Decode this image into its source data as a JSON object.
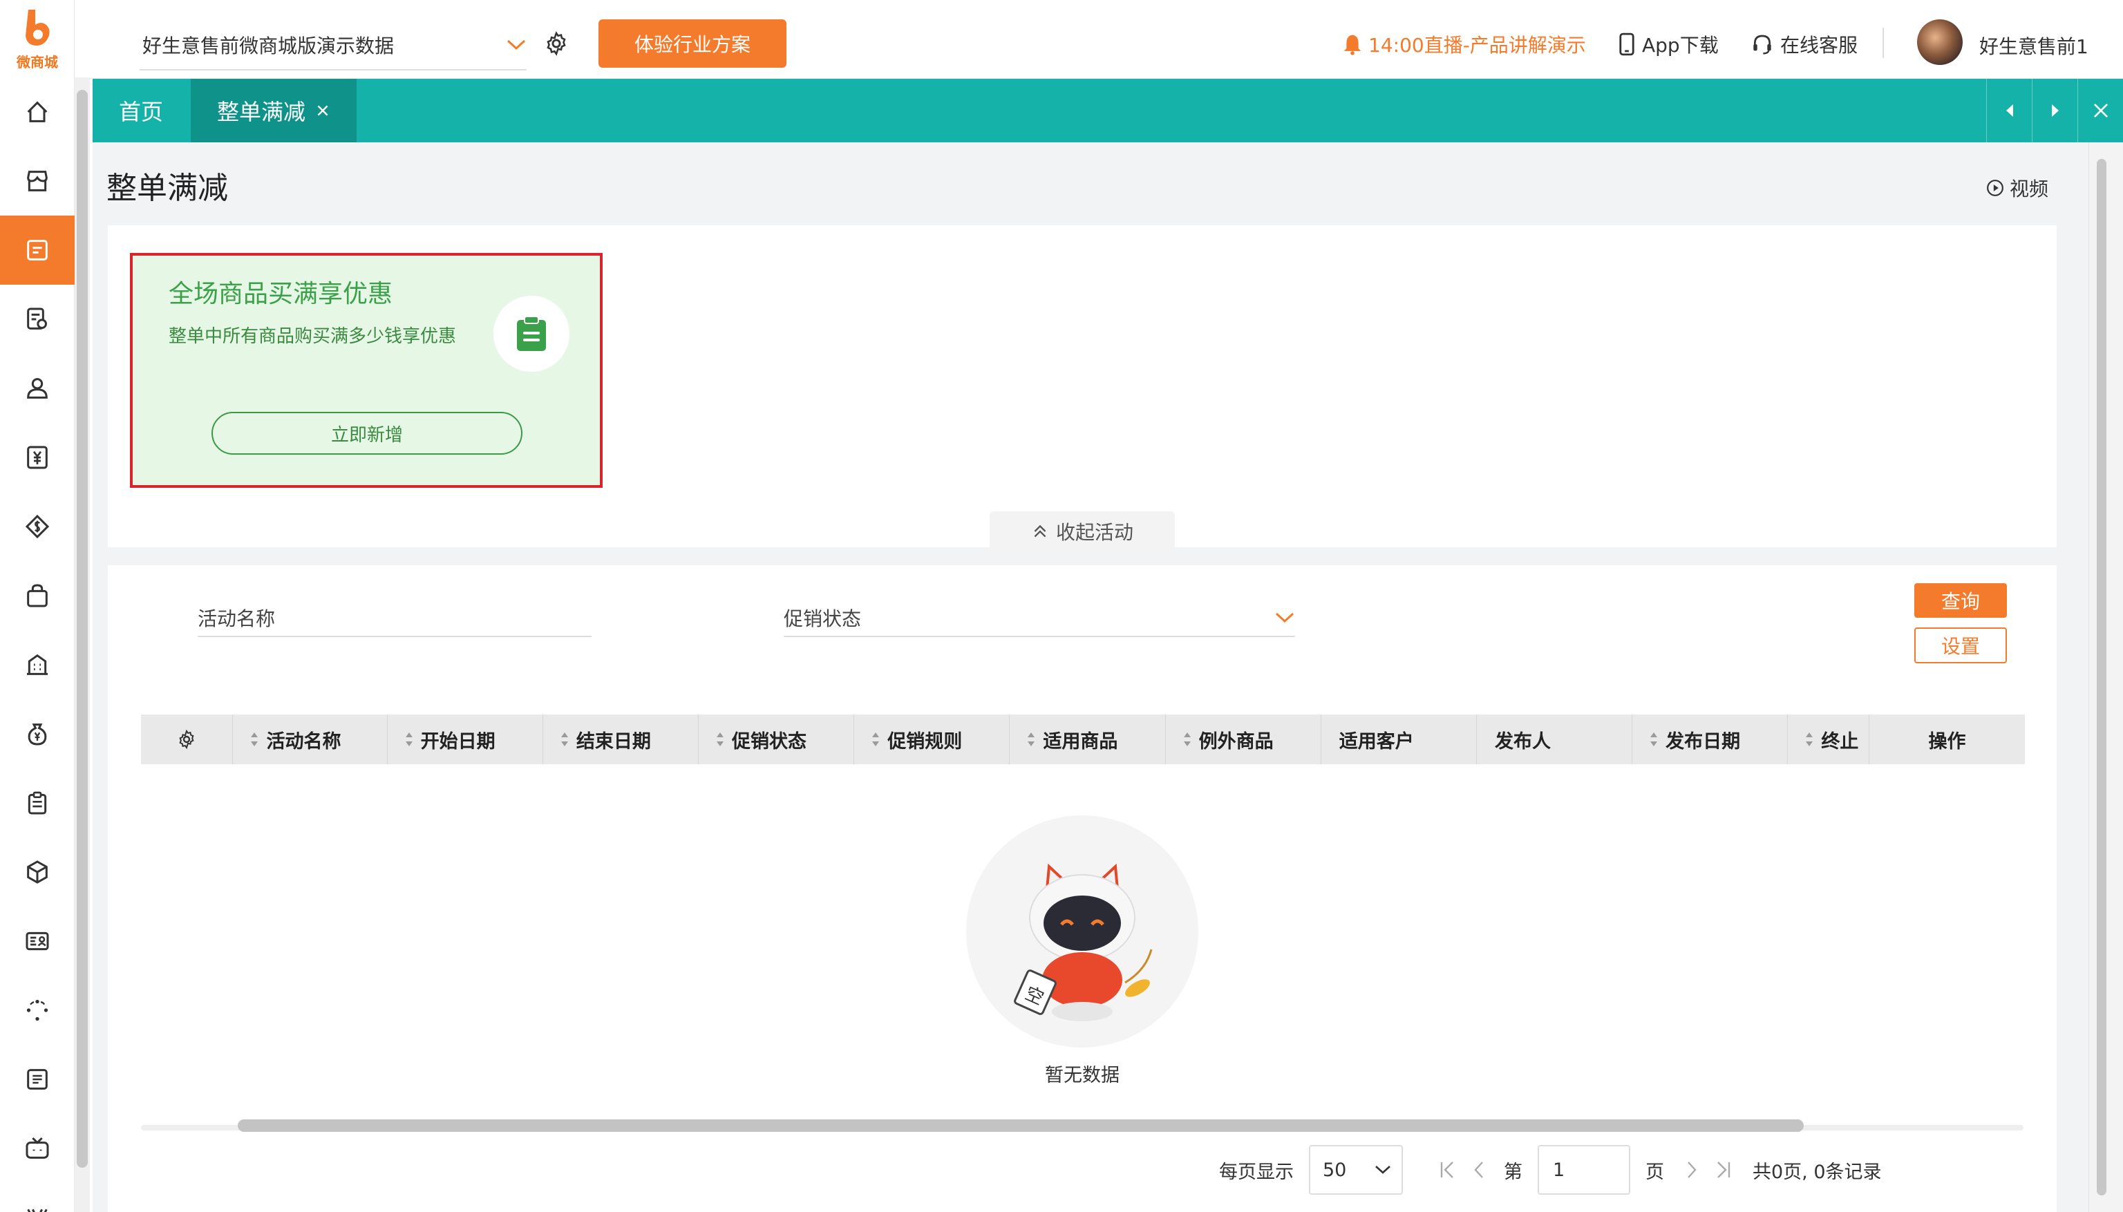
{
  "app": {
    "logo_text": "微商城",
    "accent": "#f47b2b",
    "teal": "#14b2a8"
  },
  "topbar": {
    "store_name": "好生意售前微商城版演示数据",
    "trial_button": "体验行业方案",
    "live_text": "14:00直播-产品讲解演示",
    "app_download": "App下载",
    "online_service": "在线客服",
    "username": "好生意售前1"
  },
  "sidebar": {
    "items": [
      {
        "icon": "home-icon"
      },
      {
        "icon": "store-icon"
      },
      {
        "icon": "marketing-icon",
        "active": true
      },
      {
        "icon": "order-search-icon"
      },
      {
        "icon": "customer-icon"
      },
      {
        "icon": "finance-icon"
      },
      {
        "icon": "coin-icon"
      },
      {
        "icon": "bag-icon"
      },
      {
        "icon": "building-icon"
      },
      {
        "icon": "money-bag-icon"
      },
      {
        "icon": "clipboard-icon"
      },
      {
        "icon": "box-icon"
      },
      {
        "icon": "contact-card-icon"
      },
      {
        "icon": "loading-icon"
      },
      {
        "icon": "news-icon"
      },
      {
        "icon": "tv-icon"
      },
      {
        "icon": "v-icon"
      }
    ]
  },
  "tabs": {
    "home": "首页",
    "current": "整单满减"
  },
  "page": {
    "title": "整单满减",
    "video": "视频"
  },
  "card": {
    "title": "全场商品买满享优惠",
    "desc": "整单中所有商品购买满多少钱享优惠",
    "button": "立即新增"
  },
  "collapse_label": "收起活动",
  "filters": {
    "name_label": "活动名称",
    "status_label": "促销状态",
    "query": "查询",
    "settings": "设置"
  },
  "table": {
    "columns": [
      {
        "label": "活动名称",
        "sortable": true
      },
      {
        "label": "开始日期",
        "sortable": true
      },
      {
        "label": "结束日期",
        "sortable": true
      },
      {
        "label": "促销状态",
        "sortable": true
      },
      {
        "label": "促销规则",
        "sortable": true
      },
      {
        "label": "适用商品",
        "sortable": true
      },
      {
        "label": "例外商品",
        "sortable": true
      },
      {
        "label": "适用客户",
        "sortable": false
      },
      {
        "label": "发布人",
        "sortable": false
      },
      {
        "label": "发布日期",
        "sortable": true
      },
      {
        "label": "终止",
        "sortable": true
      },
      {
        "label": "操作",
        "sortable": false
      }
    ],
    "empty_text": "暂无数据",
    "empty_badge": "空"
  },
  "pager": {
    "per_page_label": "每页显示",
    "per_page": "50",
    "page_prefix": "第",
    "page": "1",
    "page_suffix": "页",
    "summary": "共0页, 0条记录"
  }
}
